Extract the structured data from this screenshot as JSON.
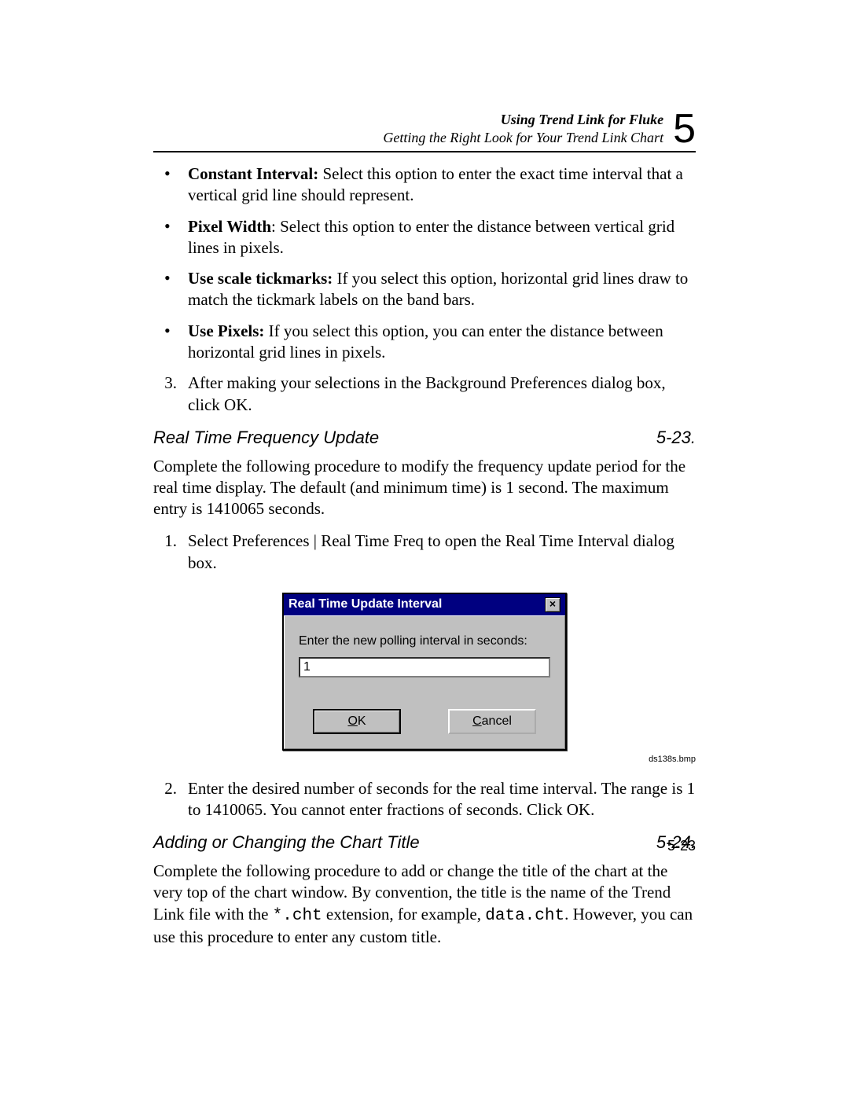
{
  "header": {
    "line1": "Using Trend Link for Fluke",
    "line2": "Getting the Right Look for Your Trend Link Chart",
    "chapter": "5"
  },
  "bullets": [
    {
      "bold": "Constant Interval:",
      "rest": " Select this option to enter the exact time interval that a vertical grid line should represent."
    },
    {
      "bold": "Pixel Width",
      "rest": ": Select this option to enter the distance between vertical grid lines in pixels."
    },
    {
      "bold": "Use scale tickmarks:",
      "rest": " If you select this option, horizontal grid lines draw to match the tickmark labels on the band bars."
    },
    {
      "bold": "Use Pixels:",
      "rest": " If you select this option, you can enter the distance between horizontal grid lines in pixels."
    }
  ],
  "step3": {
    "num": "3.",
    "text": "After making your selections in the Background Preferences dialog box, click OK."
  },
  "section1": {
    "title": "Real Time Frequency Update",
    "num": "5-23."
  },
  "section1_para": "Complete the following procedure to modify the frequency update period for the real time display. The default (and minimum time) is 1 second. The maximum entry is 1410065 seconds.",
  "s1_step1": {
    "num": "1.",
    "pre": "Select Preferences ",
    "mid": "|",
    "post": " Real Time Freq to open the Real Time Interval dialog box."
  },
  "dialog": {
    "title": "Real Time Update Interval",
    "label": "Enter the new polling interval in seconds:",
    "value": "1",
    "ok": "OK",
    "ok_u": "O",
    "ok_rest": "K",
    "cancel": "Cancel",
    "cancel_u": "C",
    "cancel_rest": "ancel"
  },
  "caption": "ds138s.bmp",
  "s1_step2": {
    "num": "2.",
    "text": "Enter the desired number of seconds for the real time interval. The range is 1 to 1410065. You cannot enter fractions of seconds. Click OK."
  },
  "section2": {
    "title": "Adding or Changing the Chart Title",
    "num": "5-24."
  },
  "section2_para_pre": "Complete the following procedure to add or change the title of the chart at the very top of the chart window. By convention, the title is the name of the Trend Link file with the ",
  "section2_mono1": "*.cht",
  "section2_mid": " extension, for example, ",
  "section2_mono2": "data.cht",
  "section2_post": ". However, you can use this procedure to enter any custom title.",
  "page_number": "5-23"
}
